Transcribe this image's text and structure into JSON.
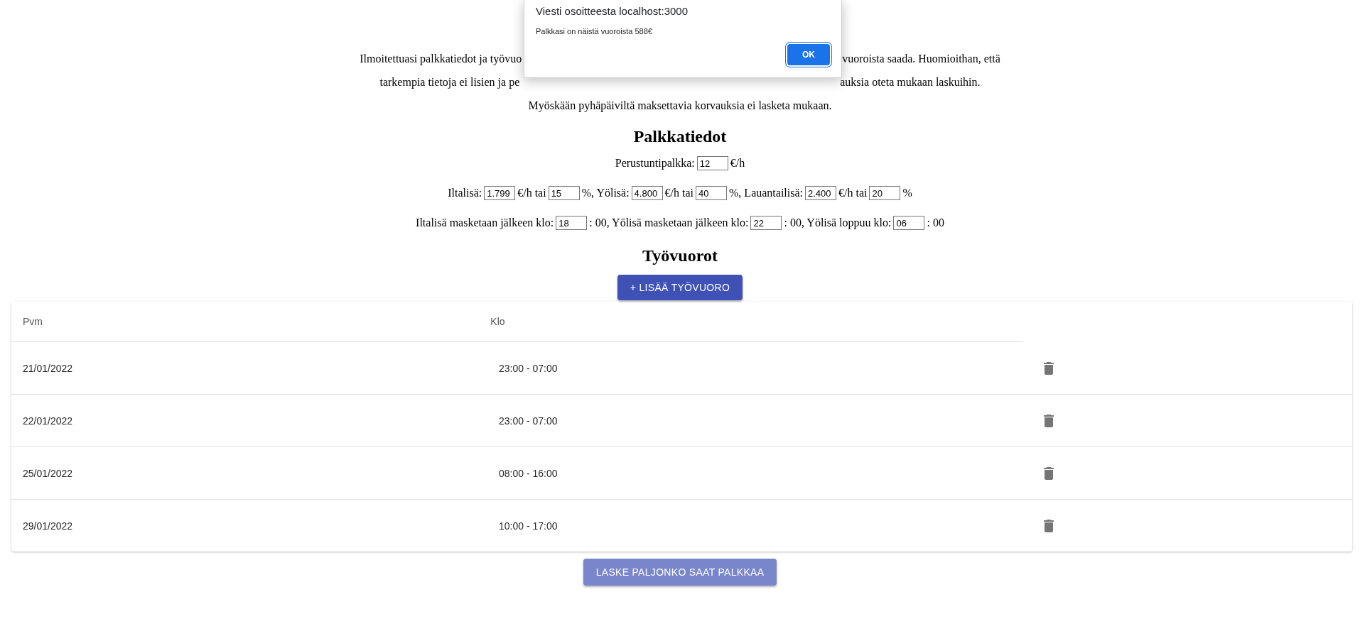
{
  "dialog": {
    "title": "Viesti osoitteesta localhost:3000",
    "message": "Palkkasi on näistä vuoroista 588€",
    "button": "OK"
  },
  "intro": [
    {
      "left": "Ilmoitettuasi palkkatiedot ja työvuo",
      "right": "vuoroista saada. Huomioithan, että"
    },
    {
      "left": "tarkempia tietoja ei lisien ja pe",
      "right": "auksia oteta mukaan laskuihin."
    },
    {
      "full": "Myöskään pyhäpäiviltä maksettavia korvauksia ei lasketa mukaan."
    }
  ],
  "pay_heading": "Palkkatiedot",
  "pay_rows": [
    [
      {
        "kind": "text",
        "text": "Perustuntipalkka:"
      },
      {
        "kind": "input",
        "value": "12"
      },
      {
        "kind": "text",
        "text": "€/h"
      }
    ],
    [
      {
        "kind": "text",
        "text": "Iltalisä:"
      },
      {
        "kind": "input",
        "value": "1.799"
      },
      {
        "kind": "text",
        "text": "€/h tai"
      },
      {
        "kind": "input",
        "value": "15"
      },
      {
        "kind": "text",
        "text": "%, Yölisä:"
      },
      {
        "kind": "input",
        "value": "4.800"
      },
      {
        "kind": "text",
        "text": "€/h tai"
      },
      {
        "kind": "input",
        "value": "40"
      },
      {
        "kind": "text",
        "text": "%, Lauantailisä:"
      },
      {
        "kind": "input",
        "value": "2.400"
      },
      {
        "kind": "text",
        "text": "€/h tai"
      },
      {
        "kind": "input",
        "value": "20"
      },
      {
        "kind": "text",
        "text": "%"
      }
    ],
    [
      {
        "kind": "text",
        "text": "Iltalisä masketaan jälkeen klo:"
      },
      {
        "kind": "input",
        "value": "18"
      },
      {
        "kind": "text",
        "text": ": 00, Yölisä masketaan jälkeen klo:"
      },
      {
        "kind": "input",
        "value": "22"
      },
      {
        "kind": "text",
        "text": ": 00, Yölisä loppuu klo:"
      },
      {
        "kind": "input",
        "value": "06"
      },
      {
        "kind": "text",
        "text": ": 00"
      }
    ]
  ],
  "shifts_heading": "Työvuorot",
  "add_button": "+ LISÄÄ TYÖVUORO",
  "table": {
    "columns": [
      "Pvm",
      "Klo"
    ],
    "rows": [
      {
        "date": "21/01/2022",
        "time": "23:00 - 07:00"
      },
      {
        "date": "22/01/2022",
        "time": "23:00 - 07:00"
      },
      {
        "date": "25/01/2022",
        "time": "08:00 - 16:00"
      },
      {
        "date": "29/01/2022",
        "time": "10:00 - 17:00"
      }
    ]
  },
  "calc_button": "LASKE PALJONKO SAAT PALKKAA"
}
